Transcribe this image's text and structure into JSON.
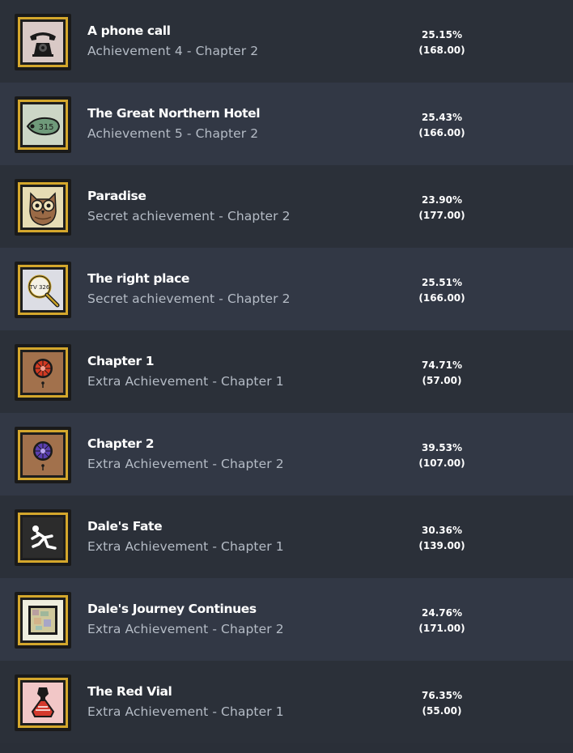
{
  "achievements": [
    {
      "title": "A phone call",
      "subtitle": "Achievement 4 - Chapter 2",
      "percent": "25.15%",
      "count": "(168.00)",
      "icon": "telephone-icon"
    },
    {
      "title": "The Great Northern Hotel",
      "subtitle": "Achievement 5 - Chapter 2",
      "percent": "25.43%",
      "count": "(166.00)",
      "icon": "room-key-tag-icon"
    },
    {
      "title": "Paradise",
      "subtitle": "Secret achievement - Chapter 2",
      "percent": "23.90%",
      "count": "(177.00)",
      "icon": "owl-icon"
    },
    {
      "title": "The right place",
      "subtitle": "Secret achievement - Chapter 2",
      "percent": "25.51%",
      "count": "(166.00)",
      "icon": "magnifying-glass-icon"
    },
    {
      "title": "Chapter 1",
      "subtitle": "Extra Achievement - Chapter 1",
      "percent": "74.71%",
      "count": "(57.00)",
      "icon": "red-seal-icon"
    },
    {
      "title": "Chapter 2",
      "subtitle": "Extra Achievement - Chapter 2",
      "percent": "39.53%",
      "count": "(107.00)",
      "icon": "blue-seal-icon"
    },
    {
      "title": "Dale's Fate",
      "subtitle": "Extra Achievement - Chapter 1",
      "percent": "30.36%",
      "count": "(139.00)",
      "icon": "falling-person-icon"
    },
    {
      "title": "Dale's Journey Continues",
      "subtitle": "Extra Achievement - Chapter 2",
      "percent": "24.76%",
      "count": "(171.00)",
      "icon": "framed-picture-icon"
    },
    {
      "title": "The Red Vial",
      "subtitle": "Extra Achievement - Chapter 1",
      "percent": "76.35%",
      "count": "(55.00)",
      "icon": "red-vial-icon"
    }
  ],
  "colors": {
    "row_dark": "#2b3039",
    "row_light": "#323845",
    "frame_gold": "#d4a72c",
    "title": "#ffffff",
    "subtitle": "#b5bcc6"
  }
}
